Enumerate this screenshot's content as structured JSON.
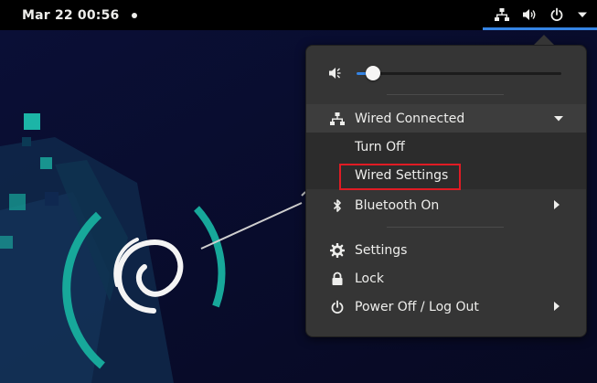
{
  "topbar": {
    "clock": "Mar 22  00:56",
    "icons": [
      "network-wired-icon",
      "volume-icon",
      "power-icon",
      "chevron-down-icon"
    ]
  },
  "system_menu": {
    "volume": {
      "icon": "speaker-low-icon",
      "level": 0.08
    },
    "wired": {
      "label": "Wired Connected",
      "icon": "network-wired-icon",
      "submenu": {
        "turn_off": "Turn Off",
        "wired_settings": "Wired Settings"
      }
    },
    "bluetooth": {
      "label": "Bluetooth On",
      "icon": "bluetooth-icon"
    },
    "settings": {
      "label": "Settings",
      "icon": "gear-icon"
    },
    "lock": {
      "label": "Lock",
      "icon": "lock-icon"
    },
    "power": {
      "label": "Power Off / Log Out",
      "icon": "power-icon"
    }
  },
  "colors": {
    "accent": "#3584e4",
    "menu_bg": "#353535",
    "highlight": "#e01b24",
    "teal": "#16a294"
  }
}
